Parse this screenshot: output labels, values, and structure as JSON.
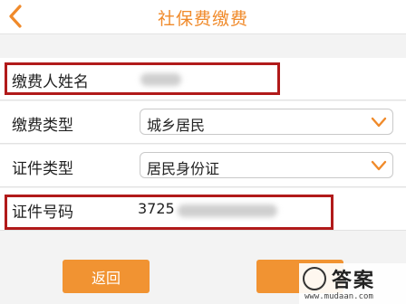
{
  "header": {
    "title": "社保费缴费",
    "back_icon": "chevron-left-icon",
    "accent": "#f08a2a"
  },
  "form": {
    "payer_name": {
      "label": "缴费人姓名",
      "value_hidden": true
    },
    "pay_type": {
      "label": "缴费类型",
      "selected": "城乡居民"
    },
    "id_type": {
      "label": "证件类型",
      "selected": "居民身份证"
    },
    "id_number": {
      "label": "证件号码",
      "value_prefix": "3725",
      "value_hidden": true
    }
  },
  "buttons": {
    "back_label": "返回",
    "color": "#f19332"
  },
  "watermark": {
    "text": "答案",
    "url": "www.mudaan.com"
  },
  "highlight_color": "#b11a1a"
}
